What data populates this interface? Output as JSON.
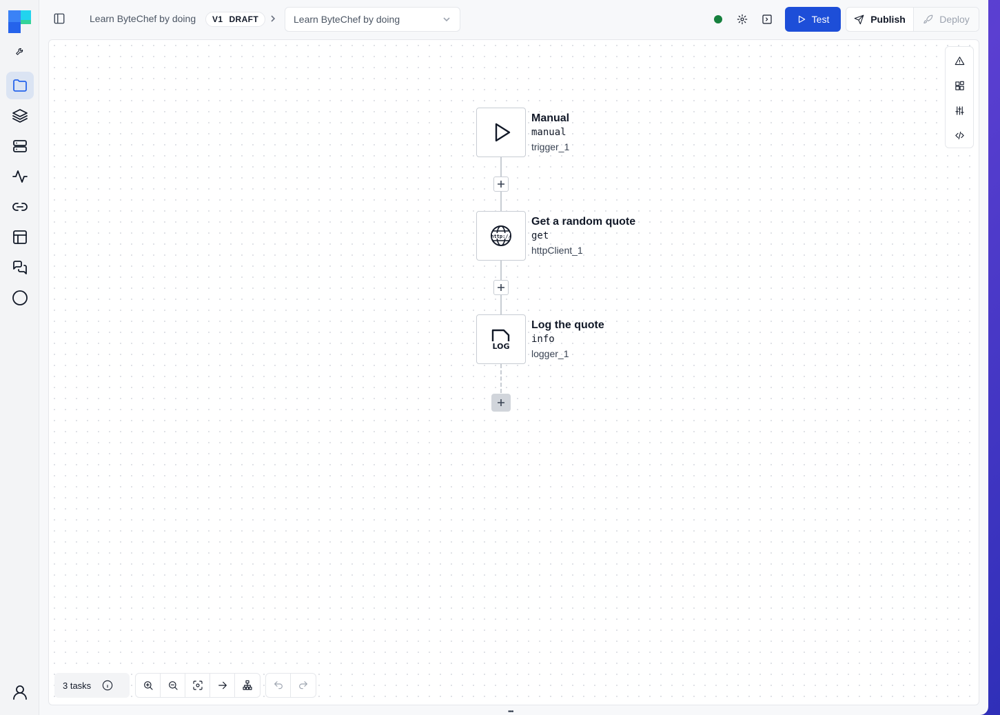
{
  "colors": {
    "accent": "#1d4ed8",
    "status_online": "#16803d",
    "active_nav": "#2563eb"
  },
  "rail": {
    "items": [
      {
        "name": "wrench-icon"
      },
      {
        "name": "folder-icon",
        "active": true
      },
      {
        "name": "layers-icon"
      },
      {
        "name": "server-icon"
      },
      {
        "name": "activity-icon"
      },
      {
        "name": "link-icon"
      },
      {
        "name": "table-icon"
      },
      {
        "name": "chat-icon"
      },
      {
        "name": "circle-icon"
      },
      {
        "name": "user-icon"
      }
    ]
  },
  "header": {
    "project_name": "Learn ByteChef by doing",
    "version_label": "V1",
    "status_label": "DRAFT",
    "workflow_select_value": "Learn ByteChef by doing",
    "test_label": "Test",
    "publish_label": "Publish",
    "deploy_label": "Deploy"
  },
  "workflow": {
    "nodes": [
      {
        "title": "Manual",
        "operation": "manual",
        "id": "trigger_1",
        "icon": "play-icon"
      },
      {
        "title": "Get a random quote",
        "operation": "get",
        "id": "httpClient_1",
        "icon": "http-globe-icon"
      },
      {
        "title": "Log the quote",
        "operation": "info",
        "id": "logger_1",
        "icon": "log-file-icon",
        "icon_text": "LOG"
      }
    ]
  },
  "side_tools": [
    "warning-icon",
    "components-icon",
    "sliders-icon",
    "code-icon"
  ],
  "bottom": {
    "tasks_label": "3 tasks",
    "zoom_tools": [
      "zoom-in-icon",
      "zoom-out-icon",
      "fit-view-icon",
      "arrow-right-icon",
      "layout-icon"
    ],
    "history_tools": [
      "undo-icon",
      "redo-icon"
    ]
  }
}
